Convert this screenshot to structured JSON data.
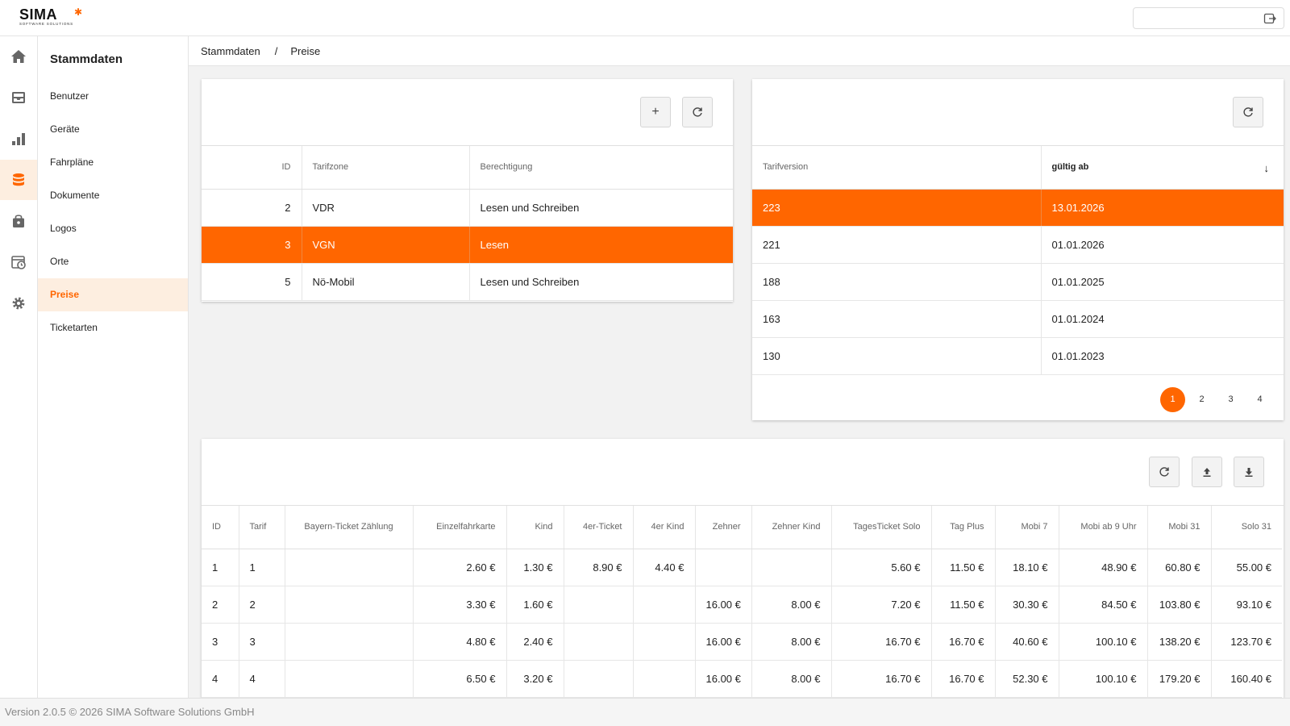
{
  "brand": {
    "logo_text": "SIMA",
    "logo_sub": "SOFTWARE SOLUTIONS",
    "accent": "#ff6600"
  },
  "icon_nav": [
    "home-icon",
    "inbox-icon",
    "chart-icon",
    "database-icon",
    "bag-icon",
    "calendar-clock-icon",
    "gear-icon"
  ],
  "sidebar": {
    "title": "Stammdaten",
    "items": [
      {
        "label": "Benutzer"
      },
      {
        "label": "Geräte"
      },
      {
        "label": "Fahrpläne"
      },
      {
        "label": "Dokumente"
      },
      {
        "label": "Logos"
      },
      {
        "label": "Orte"
      },
      {
        "label": "Preise",
        "active": true
      },
      {
        "label": "Ticketarten"
      }
    ]
  },
  "breadcrumb": {
    "root": "Stammdaten",
    "separator": "/",
    "current": "Preise"
  },
  "zones": {
    "add_label": "+",
    "columns": [
      "ID",
      "Tarifzone",
      "Berechtigung"
    ],
    "rows": [
      [
        "2",
        "VDR",
        "Lesen und Schreiben"
      ],
      [
        "3",
        "VGN",
        "Lesen"
      ],
      [
        "5",
        "Nö-Mobil",
        "Lesen und Schreiben"
      ]
    ],
    "selected_row": 1
  },
  "versions": {
    "columns": [
      "Tarifversion",
      "gültig ab"
    ],
    "sort_indicator": "↓",
    "rows": [
      [
        "223",
        "13.01.2026"
      ],
      [
        "221",
        "01.01.2026"
      ],
      [
        "188",
        "01.01.2025"
      ],
      [
        "163",
        "01.01.2024"
      ],
      [
        "130",
        "01.01.2023"
      ]
    ],
    "selected_row": 0,
    "pages": [
      "1",
      "2",
      "3",
      "4"
    ],
    "active_page": 0
  },
  "prices": {
    "columns": [
      "ID",
      "Tarif",
      "Bayern-Ticket Zählung",
      "Einzelfahrkarte",
      "Kind",
      "4er-Ticket",
      "4er Kind",
      "Zehner",
      "Zehner Kind",
      "TagesTicket Solo",
      "Tag Plus",
      "Mobi 7",
      "Mobi ab 9 Uhr",
      "Mobi 31",
      "Solo 31"
    ],
    "rows": [
      [
        "1",
        "1",
        "",
        "2.60 €",
        "1.30 €",
        "8.90 €",
        "4.40 €",
        "",
        "",
        "5.60 €",
        "11.50 €",
        "18.10 €",
        "48.90 €",
        "60.80 €",
        "55.00 €"
      ],
      [
        "2",
        "2",
        "",
        "3.30 €",
        "1.60 €",
        "",
        "",
        "16.00 €",
        "8.00 €",
        "7.20 €",
        "11.50 €",
        "30.30 €",
        "84.50 €",
        "103.80 €",
        "93.10 €"
      ],
      [
        "3",
        "3",
        "",
        "4.80 €",
        "2.40 €",
        "",
        "",
        "16.00 €",
        "8.00 €",
        "16.70 €",
        "16.70 €",
        "40.60 €",
        "100.10 €",
        "138.20 €",
        "123.70 €"
      ],
      [
        "4",
        "4",
        "",
        "6.50 €",
        "3.20 €",
        "",
        "",
        "16.00 €",
        "8.00 €",
        "16.70 €",
        "16.70 €",
        "52.30 €",
        "100.10 €",
        "179.20 €",
        "160.40 €"
      ]
    ]
  },
  "footer": {
    "text": "Version 2.0.5 © 2026 SIMA Software Solutions GmbH"
  }
}
